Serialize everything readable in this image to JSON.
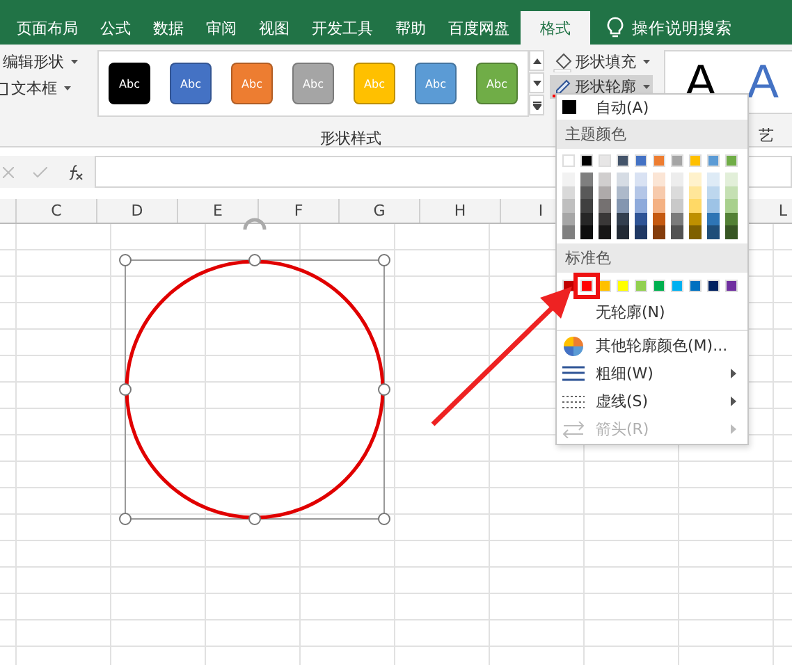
{
  "tabs": [
    {
      "label": "页面布局",
      "selected": false
    },
    {
      "label": "公式",
      "selected": false
    },
    {
      "label": "数据",
      "selected": false
    },
    {
      "label": "审阅",
      "selected": false
    },
    {
      "label": "视图",
      "selected": false
    },
    {
      "label": "开发工具",
      "selected": false
    },
    {
      "label": "帮助",
      "selected": false
    },
    {
      "label": "百度网盘",
      "selected": false
    },
    {
      "label": "格式",
      "selected": true
    }
  ],
  "tell_me": {
    "placeholder": "操作说明搜索"
  },
  "ribbon": {
    "insert_items": [
      {
        "label": "编辑形状",
        "kind": "edit-shape"
      },
      {
        "label": "文本框",
        "kind": "text-box"
      }
    ],
    "styles": [
      {
        "label": "Abc",
        "color": "#000000"
      },
      {
        "label": "Abc",
        "color": "#4472c4"
      },
      {
        "label": "Abc",
        "color": "#ed7d31"
      },
      {
        "label": "Abc",
        "color": "#a5a5a5"
      },
      {
        "label": "Abc",
        "color": "#ffc000"
      },
      {
        "label": "Abc",
        "color": "#5b9bd5"
      },
      {
        "label": "Abc",
        "color": "#70ad47"
      }
    ],
    "style_buttons": [
      {
        "label": "形状填充",
        "kind": "fill",
        "pressed": false
      },
      {
        "label": "形状轮廓",
        "kind": "outline",
        "pressed": true
      }
    ],
    "group_label": "形状样式",
    "wordart": [
      {
        "label": "A",
        "color": "#000000"
      },
      {
        "label": "A",
        "color": "#4472c4"
      }
    ],
    "wordart_group_label": "艺"
  },
  "columns": [
    "C",
    "D",
    "E",
    "F",
    "G",
    "H",
    "I"
  ],
  "far_columns": [
    "L"
  ],
  "outline_menu": {
    "auto": {
      "label": "自动(A)",
      "color": "#000000"
    },
    "theme_header": "主题颜色",
    "theme_colors": [
      {
        "color": "#ffffff",
        "shades": [
          {
            "color": "#f2f2f2"
          },
          {
            "color": "#d9d9d9"
          },
          {
            "color": "#bfbfbf"
          },
          {
            "color": "#a6a6a6"
          },
          {
            "color": "#808080"
          }
        ]
      },
      {
        "color": "#000000",
        "shades": [
          {
            "color": "#7f7f7f"
          },
          {
            "color": "#595959"
          },
          {
            "color": "#404040"
          },
          {
            "color": "#262626"
          },
          {
            "color": "#0d0d0d"
          }
        ]
      },
      {
        "color": "#e7e6e6",
        "shades": [
          {
            "color": "#d0cece"
          },
          {
            "color": "#aeaaaa"
          },
          {
            "color": "#757171"
          },
          {
            "color": "#3a3838"
          },
          {
            "color": "#171616"
          }
        ]
      },
      {
        "color": "#44546a",
        "shades": [
          {
            "color": "#d6dce4"
          },
          {
            "color": "#adb9ca"
          },
          {
            "color": "#8496b0"
          },
          {
            "color": "#333f4f"
          },
          {
            "color": "#222a35"
          }
        ]
      },
      {
        "color": "#4472c4",
        "shades": [
          {
            "color": "#d9e2f3"
          },
          {
            "color": "#b4c6e7"
          },
          {
            "color": "#8eaadb"
          },
          {
            "color": "#2f5496"
          },
          {
            "color": "#1f3864"
          }
        ]
      },
      {
        "color": "#ed7d31",
        "shades": [
          {
            "color": "#fbe5d5"
          },
          {
            "color": "#f7caac"
          },
          {
            "color": "#f4b183"
          },
          {
            "color": "#c55a11"
          },
          {
            "color": "#843c0b"
          }
        ]
      },
      {
        "color": "#a5a5a5",
        "shades": [
          {
            "color": "#ededed"
          },
          {
            "color": "#dbdbdb"
          },
          {
            "color": "#c9c9c9"
          },
          {
            "color": "#7b7b7b"
          },
          {
            "color": "#525252"
          }
        ]
      },
      {
        "color": "#ffc000",
        "shades": [
          {
            "color": "#fff2cc"
          },
          {
            "color": "#ffe699"
          },
          {
            "color": "#ffd966"
          },
          {
            "color": "#bf9000"
          },
          {
            "color": "#7f6000"
          }
        ]
      },
      {
        "color": "#5b9bd5",
        "shades": [
          {
            "color": "#deebf6"
          },
          {
            "color": "#bdd7ee"
          },
          {
            "color": "#9dc3e6"
          },
          {
            "color": "#2e75b5"
          },
          {
            "color": "#1f4e79"
          }
        ]
      },
      {
        "color": "#70ad47",
        "shades": [
          {
            "color": "#e2efd9"
          },
          {
            "color": "#c5e0b3"
          },
          {
            "color": "#a8d08d"
          },
          {
            "color": "#538135"
          },
          {
            "color": "#375623"
          }
        ]
      }
    ],
    "standard_header": "标准色",
    "standard_colors": [
      {
        "color": "#c00000",
        "selected": false
      },
      {
        "color": "#ff0000",
        "selected": true
      },
      {
        "color": "#ffc000",
        "selected": false
      },
      {
        "color": "#ffff00",
        "selected": false
      },
      {
        "color": "#92d050",
        "selected": false
      },
      {
        "color": "#00b050",
        "selected": false
      },
      {
        "color": "#00b0f0",
        "selected": false
      },
      {
        "color": "#0070c0",
        "selected": false
      },
      {
        "color": "#002060",
        "selected": false
      },
      {
        "color": "#7030a0",
        "selected": false
      }
    ],
    "items": [
      {
        "kind": "no-outline",
        "label": "无轮廓(N)",
        "submenu": false,
        "disabled": false
      },
      {
        "kind": "more-colors",
        "label": "其他轮廓颜色(M)...",
        "submenu": false,
        "disabled": false
      },
      {
        "kind": "weight",
        "label": "粗细(W)",
        "submenu": true,
        "disabled": false
      },
      {
        "kind": "dashes",
        "label": "虚线(S)",
        "submenu": true,
        "disabled": false
      },
      {
        "kind": "arrows",
        "label": "箭头(R)",
        "submenu": true,
        "disabled": true
      }
    ]
  }
}
